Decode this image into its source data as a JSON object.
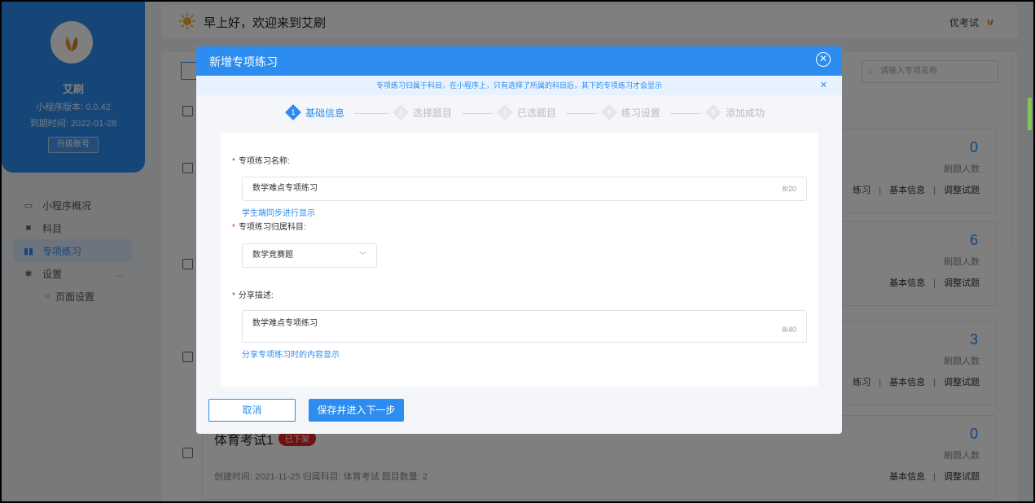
{
  "header": {
    "greeting": "早上好，欢迎来到艾刷",
    "user_name": "优考试"
  },
  "sidebar": {
    "brand_name": "艾刷",
    "version": "小程序版本: 0.0.42",
    "expire": "到期时间: 2022-01-28",
    "upgrade_label": "升级账号",
    "items": [
      {
        "label": "小程序概况",
        "icon": "monitor-icon"
      },
      {
        "label": "科目",
        "icon": "book-icon"
      },
      {
        "label": "专项练习",
        "icon": "library-icon",
        "active": true
      },
      {
        "label": "设置",
        "icon": "gear-icon"
      },
      {
        "label": "页面设置",
        "icon": "dot-icon"
      }
    ]
  },
  "main": {
    "search_placeholder": "请输入专项名称",
    "rows": [
      {
        "count": "0",
        "count_label": "刷题人数",
        "actions": [
          "练习",
          "基本信息",
          "调整试题"
        ]
      },
      {
        "count": "6",
        "count_label": "刷题人数",
        "actions": [
          "基本信息",
          "调整试题"
        ]
      },
      {
        "count": "3",
        "count_label": "刷题人数",
        "actions": [
          "练习",
          "基本信息",
          "调整试题"
        ]
      },
      {
        "title": "体育考试1",
        "badge": "已下架",
        "meta": "创建时间: 2021-11-25   归属科目: 体育考试   题目数量: 2",
        "count": "0",
        "count_label": "刷题人数",
        "actions": [
          "基本信息",
          "调整试题"
        ]
      }
    ]
  },
  "modal": {
    "title": "新增专项练习",
    "notice": "专项练习归属于科目，在小程序上，只有选择了所属的科目后，其下的专项练习才会显示",
    "steps": [
      {
        "num": "1",
        "label": "基础信息"
      },
      {
        "num": "2",
        "label": "选择题目"
      },
      {
        "num": "3",
        "label": "已选题目"
      },
      {
        "num": "4",
        "label": "练习设置"
      },
      {
        "num": "5",
        "label": "添加成功"
      }
    ],
    "form": {
      "name_label": "专项练习名称:",
      "name_value": "数学难点专项练习",
      "name_counter": "8/20",
      "name_hint": "学生端同步进行显示",
      "subject_label": "专项练习归属科目:",
      "subject_value": "数学竞赛题",
      "desc_label": "分享描述:",
      "desc_value": "数学难点专项练习",
      "desc_counter": "8/40",
      "desc_hint": "分享专项练习时的内容显示"
    },
    "cancel_label": "取消",
    "save_label": "保存并进入下一步"
  },
  "colors": {
    "accent": "#2d8cf0",
    "danger": "#e02020"
  }
}
